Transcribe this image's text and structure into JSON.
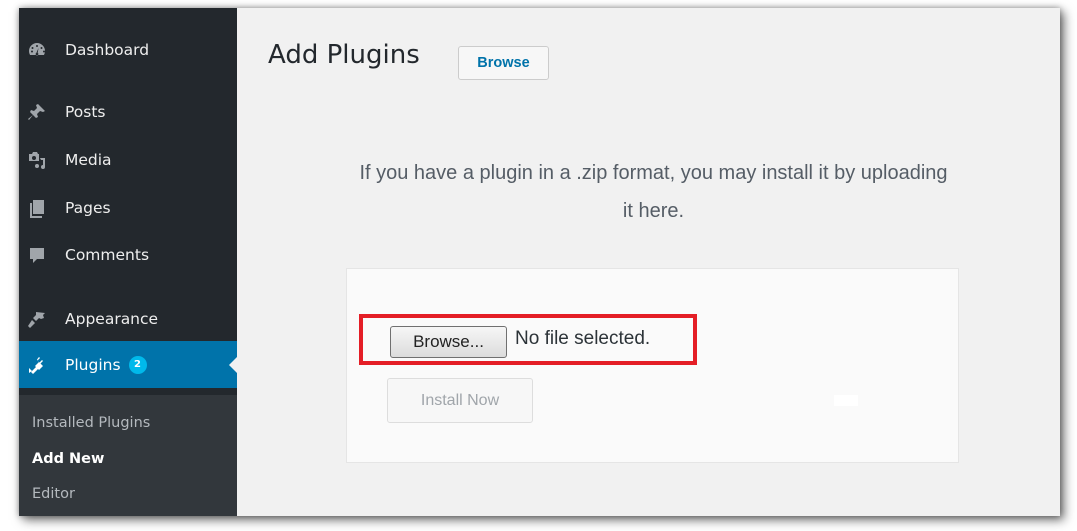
{
  "sidebar": {
    "items": [
      {
        "label": "Dashboard",
        "icon": "dashboard-icon"
      },
      {
        "label": "Posts",
        "icon": "pin-icon"
      },
      {
        "label": "Media",
        "icon": "media-icon"
      },
      {
        "label": "Pages",
        "icon": "pages-icon"
      },
      {
        "label": "Comments",
        "icon": "comment-icon"
      },
      {
        "label": "Appearance",
        "icon": "paintbrush-icon"
      },
      {
        "label": "Plugins",
        "icon": "plugin-icon",
        "badge": "2",
        "active": true
      }
    ],
    "submenu": [
      {
        "label": "Installed Plugins"
      },
      {
        "label": "Add New",
        "current": true
      },
      {
        "label": "Editor"
      }
    ]
  },
  "header": {
    "title": "Add Plugins",
    "browse_label": "Browse"
  },
  "upload": {
    "help_line1": "If you have a plugin in a .zip format, you may install it by uploading",
    "help_line2": "it here.",
    "browse_button": "Browse...",
    "file_status": "No file selected.",
    "install_button": "Install Now"
  },
  "colors": {
    "sidebar_bg": "#23282d",
    "active_bg": "#0073aa",
    "badge_bg": "#00b9eb",
    "highlight": "#e41e26"
  }
}
